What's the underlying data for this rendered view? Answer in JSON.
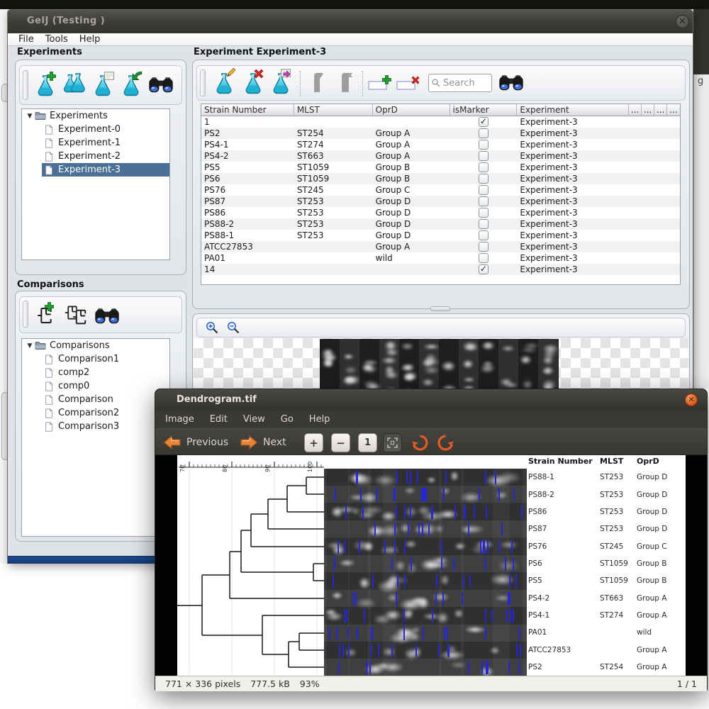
{
  "screen": {
    "behind_text": "g"
  },
  "gelj": {
    "title": "GelJ (Testing )",
    "menu": [
      "File",
      "Tools",
      "Help"
    ],
    "experiments": {
      "header": "Experiments",
      "toolbar_icons": [
        "new-experiment-flask-icon",
        "duplicate-experiment-flasks-icon",
        "load-experiment-flask-icon",
        "import-experiment-flask-icon",
        "search-binoculars-icon"
      ],
      "root": "Experiments",
      "items": [
        "Experiment-0",
        "Experiment-1",
        "Experiment-2",
        "Experiment-3"
      ],
      "selected": "Experiment-3"
    },
    "comparisons": {
      "header": "Comparisons",
      "toolbar_icons": [
        "new-comparison-icon",
        "duplicate-comparison-icon",
        "search-binoculars-icon"
      ],
      "root": "Comparisons",
      "items": [
        "Comparison1",
        "comp2",
        "comp0",
        "Comparison",
        "Comparison2",
        "Comparison3"
      ]
    },
    "experiment": {
      "header": "Experiment Experiment-3",
      "toolbar_icons": [
        "edit-experiment-flask-icon",
        "delete-experiment-flask-icon",
        "export-experiment-flask-icon",
        "lane-tool-icon",
        "lane-flag-tool-icon",
        "add-row-icon",
        "delete-row-icon",
        "search-binoculars-icon"
      ],
      "search_placeholder": "Search",
      "columns": [
        "Strain Number",
        "MLST",
        "OprD",
        "isMarker",
        "Experiment",
        "...",
        "...",
        "...",
        "..."
      ],
      "rows": [
        {
          "strain": "1",
          "mlst": "",
          "oprd": "",
          "marker": true,
          "exp": "Experiment-3"
        },
        {
          "strain": "PS2",
          "mlst": "ST254",
          "oprd": "Group A",
          "marker": false,
          "exp": "Experiment-3"
        },
        {
          "strain": "PS4-1",
          "mlst": "ST274",
          "oprd": "Group A",
          "marker": false,
          "exp": "Experiment-3"
        },
        {
          "strain": "PS4-2",
          "mlst": "ST663",
          "oprd": "Group A",
          "marker": false,
          "exp": "Experiment-3"
        },
        {
          "strain": "PS5",
          "mlst": "ST1059",
          "oprd": "Group B",
          "marker": false,
          "exp": "Experiment-3"
        },
        {
          "strain": "PS6",
          "mlst": "ST1059",
          "oprd": "Group B",
          "marker": false,
          "exp": "Experiment-3"
        },
        {
          "strain": "PS76",
          "mlst": "ST245",
          "oprd": "Group C",
          "marker": false,
          "exp": "Experiment-3"
        },
        {
          "strain": "PS87",
          "mlst": "ST253",
          "oprd": "Group D",
          "marker": false,
          "exp": "Experiment-3"
        },
        {
          "strain": "PS86",
          "mlst": "ST253",
          "oprd": "Group D",
          "marker": false,
          "exp": "Experiment-3"
        },
        {
          "strain": "PS88-2",
          "mlst": "ST253",
          "oprd": "Group D",
          "marker": false,
          "exp": "Experiment-3"
        },
        {
          "strain": "PS88-1",
          "mlst": "ST253",
          "oprd": "Group D",
          "marker": false,
          "exp": "Experiment-3"
        },
        {
          "strain": "ATCC27853",
          "mlst": "",
          "oprd": "Group A",
          "marker": false,
          "exp": "Experiment-3"
        },
        {
          "strain": "PA01",
          "mlst": "",
          "oprd": "wild",
          "marker": false,
          "exp": "Experiment-3"
        },
        {
          "strain": "14",
          "mlst": "",
          "oprd": "",
          "marker": true,
          "exp": "Experiment-3"
        }
      ]
    },
    "gel_toolbar_icons": [
      "zoom-in-magnifier-icon",
      "zoom-out-magnifier-icon"
    ]
  },
  "viewer": {
    "title": "Dendrogram.tif",
    "menu": [
      "Image",
      "Edit",
      "View",
      "Go",
      "Help"
    ],
    "nav": {
      "previous": "Previous",
      "next": "Next"
    },
    "toolbar_icons": [
      "previous-arrow-icon",
      "next-arrow-icon",
      "zoom-in-button",
      "zoom-out-button",
      "normal-size-button",
      "best-fit-button",
      "rotate-left-icon",
      "rotate-right-icon"
    ],
    "status": {
      "dimensions": "771 × 336 pixels",
      "filesize": "777.5 kB",
      "zoom": "93%",
      "page": "1 / 1"
    },
    "image": {
      "ruler_labels": [
        "70",
        "80",
        "90",
        "100"
      ],
      "columns": [
        "Strain Number",
        "MLST",
        "OprD"
      ],
      "rows": [
        {
          "strain": "PS88-1",
          "mlst": "ST253",
          "oprd": "Group D"
        },
        {
          "strain": "PS88-2",
          "mlst": "ST253",
          "oprd": "Group D"
        },
        {
          "strain": "PS86",
          "mlst": "ST253",
          "oprd": "Group D"
        },
        {
          "strain": "PS87",
          "mlst": "ST253",
          "oprd": "Group D"
        },
        {
          "strain": "PS76",
          "mlst": "ST245",
          "oprd": "Group C"
        },
        {
          "strain": "PS6",
          "mlst": "ST1059",
          "oprd": "Group B"
        },
        {
          "strain": "PS5",
          "mlst": "ST1059",
          "oprd": "Group B"
        },
        {
          "strain": "PS4-2",
          "mlst": "ST663",
          "oprd": "Group A"
        },
        {
          "strain": "PS4-1",
          "mlst": "ST274",
          "oprd": "Group A"
        },
        {
          "strain": "PA01",
          "mlst": "",
          "oprd": "wild"
        },
        {
          "strain": "ATCC27853",
          "mlst": "",
          "oprd": "Group A"
        },
        {
          "strain": "PS2",
          "mlst": "ST254",
          "oprd": "Group A"
        }
      ]
    }
  }
}
